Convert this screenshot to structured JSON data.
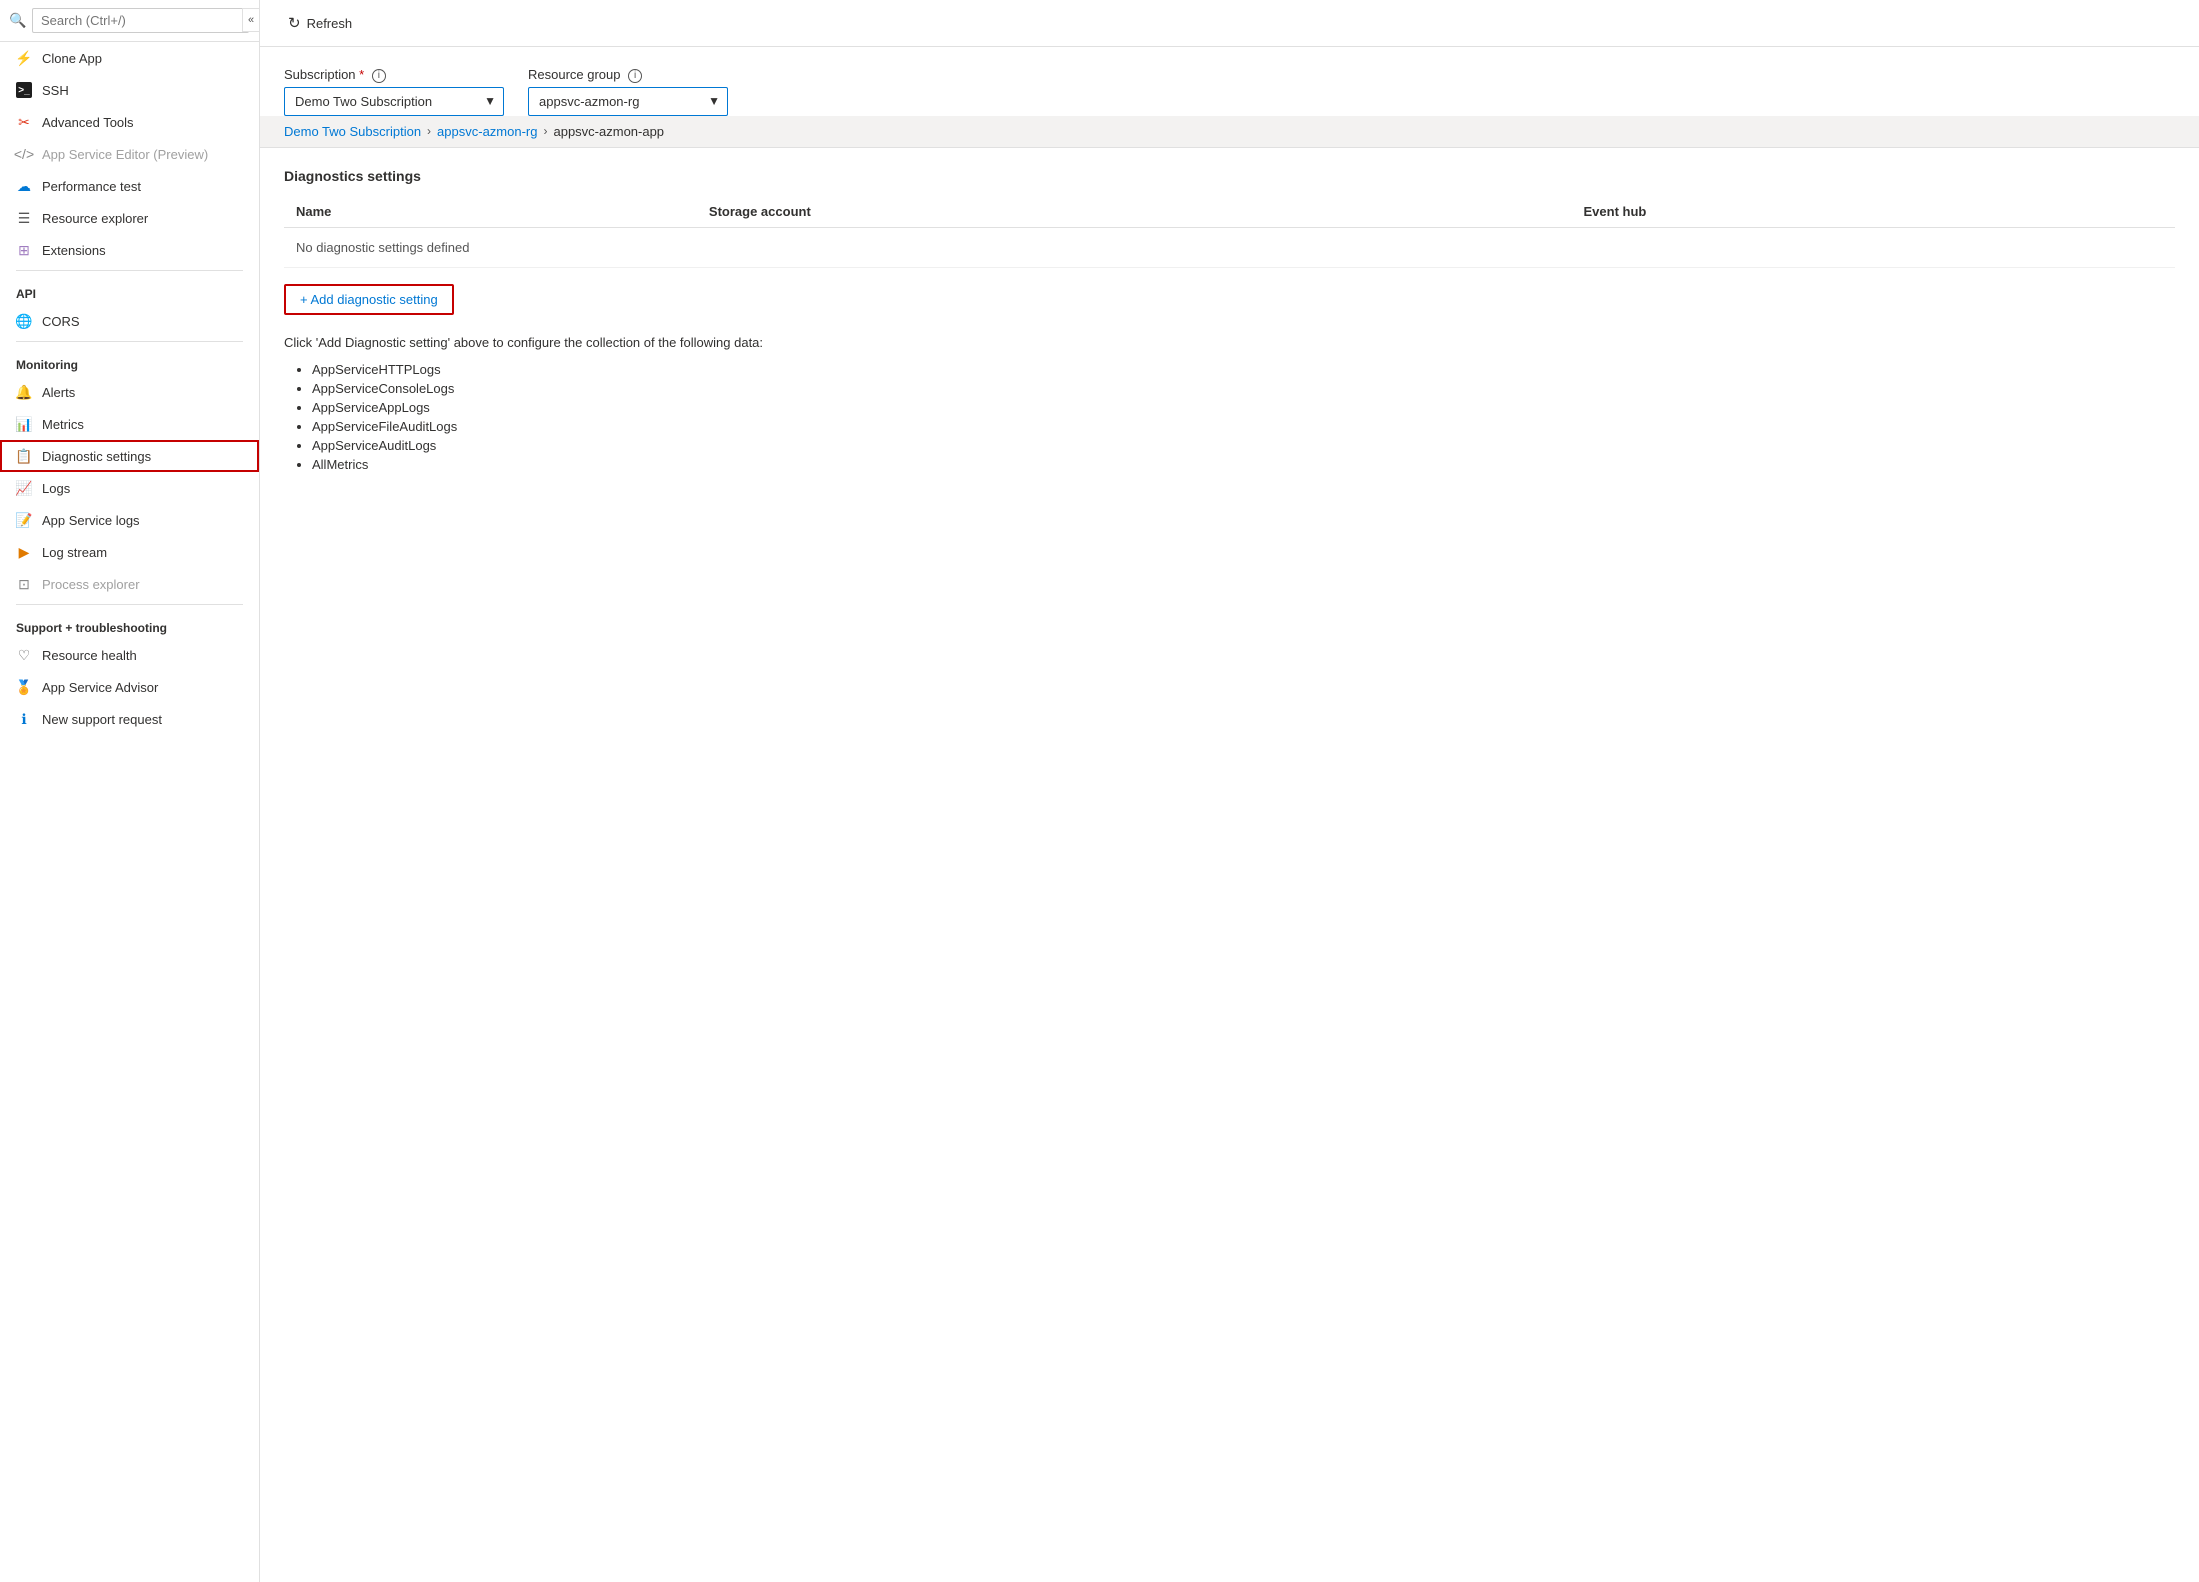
{
  "sidebar": {
    "search_placeholder": "Search (Ctrl+/)",
    "items": [
      {
        "id": "clone-app",
        "label": "Clone App",
        "icon": "clone",
        "section": null,
        "disabled": false
      },
      {
        "id": "ssh",
        "label": "SSH",
        "icon": "ssh",
        "section": null,
        "disabled": false
      },
      {
        "id": "advanced-tools",
        "label": "Advanced Tools",
        "icon": "advanced",
        "section": null,
        "disabled": false
      },
      {
        "id": "app-service-editor",
        "label": "App Service Editor (Preview)",
        "icon": "editor",
        "section": null,
        "disabled": true
      },
      {
        "id": "performance-test",
        "label": "Performance test",
        "icon": "perf",
        "section": null,
        "disabled": false
      },
      {
        "id": "resource-explorer",
        "label": "Resource explorer",
        "icon": "explorer",
        "section": null,
        "disabled": false
      },
      {
        "id": "extensions",
        "label": "Extensions",
        "icon": "extensions",
        "section": null,
        "disabled": false
      }
    ],
    "sections": [
      {
        "label": "API",
        "items": [
          {
            "id": "cors",
            "label": "CORS",
            "icon": "cors",
            "disabled": false
          }
        ]
      },
      {
        "label": "Monitoring",
        "items": [
          {
            "id": "alerts",
            "label": "Alerts",
            "icon": "alerts",
            "disabled": false
          },
          {
            "id": "metrics",
            "label": "Metrics",
            "icon": "metrics",
            "disabled": false
          },
          {
            "id": "diagnostic-settings",
            "label": "Diagnostic settings",
            "icon": "diagnostic",
            "disabled": false,
            "active": true
          },
          {
            "id": "logs",
            "label": "Logs",
            "icon": "logs",
            "disabled": false
          },
          {
            "id": "app-service-logs",
            "label": "App Service logs",
            "icon": "appsvclogs",
            "disabled": false
          },
          {
            "id": "log-stream",
            "label": "Log stream",
            "icon": "logstream",
            "disabled": false
          },
          {
            "id": "process-explorer",
            "label": "Process explorer",
            "icon": "procexplorer",
            "disabled": true
          }
        ]
      },
      {
        "label": "Support + troubleshooting",
        "items": [
          {
            "id": "resource-health",
            "label": "Resource health",
            "icon": "health",
            "disabled": false
          },
          {
            "id": "app-service-advisor",
            "label": "App Service Advisor",
            "icon": "advisor",
            "disabled": false
          },
          {
            "id": "new-support-request",
            "label": "New support request",
            "icon": "support",
            "disabled": false
          }
        ]
      }
    ]
  },
  "toolbar": {
    "refresh_label": "Refresh"
  },
  "subscription": {
    "label": "Subscription",
    "required": true,
    "value": "Demo Two Subscription",
    "options": [
      "Demo Two Subscription"
    ]
  },
  "resource_group": {
    "label": "Resource group",
    "value": "appsvc-azmon-rg",
    "options": [
      "appsvc-azmon-rg"
    ]
  },
  "breadcrumb": {
    "parts": [
      {
        "id": "sub",
        "label": "Demo Two Subscription",
        "link": true
      },
      {
        "id": "rg",
        "label": "appsvc-azmon-rg",
        "link": true
      },
      {
        "id": "app",
        "label": "appsvc-azmon-app",
        "link": false
      }
    ]
  },
  "diagnostics": {
    "section_title": "Diagnostics settings",
    "columns": [
      "Name",
      "Storage account",
      "Event hub"
    ],
    "empty_message": "No diagnostic settings defined",
    "add_button_label": "+ Add diagnostic setting",
    "info_text": "Click 'Add Diagnostic setting' above to configure the collection of the following data:",
    "data_items": [
      "AppServiceHTTPLogs",
      "AppServiceConsoleLogs",
      "AppServiceAppLogs",
      "AppServiceFileAuditLogs",
      "AppServiceAuditLogs",
      "AllMetrics"
    ]
  }
}
